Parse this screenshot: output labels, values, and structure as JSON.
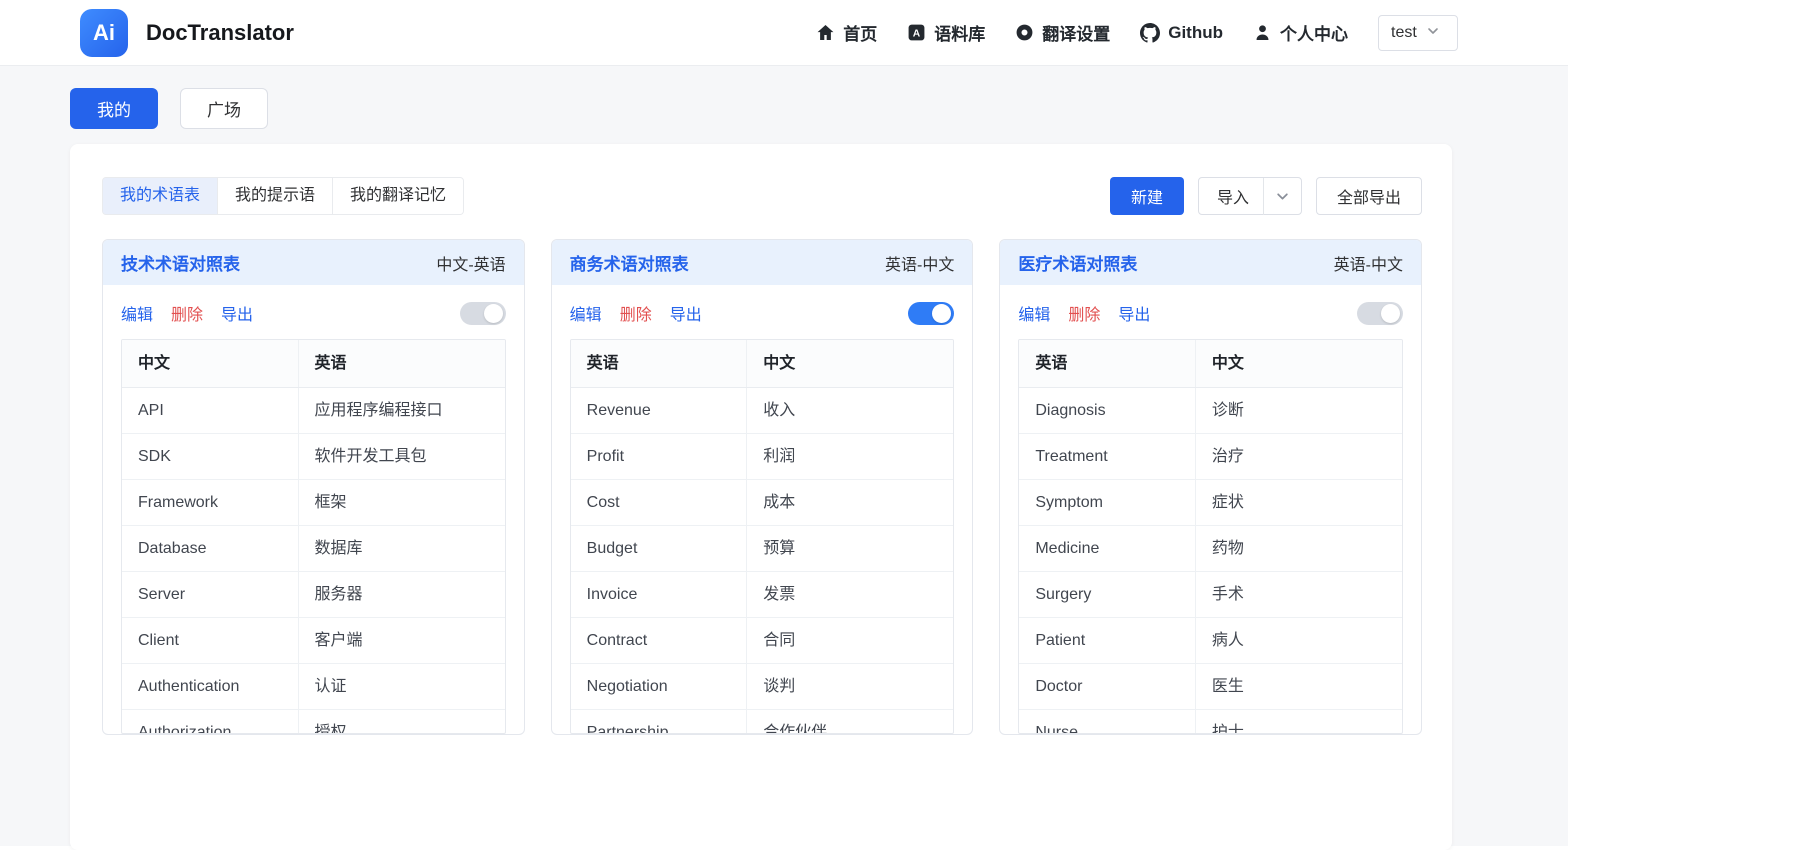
{
  "header": {
    "logo_text": "Ai",
    "app_name": "DocTranslator",
    "nav": [
      {
        "label": "首页",
        "icon": "home-icon"
      },
      {
        "label": "语料库",
        "icon": "corpus-icon"
      },
      {
        "label": "翻译设置",
        "icon": "settings-icon"
      },
      {
        "label": "Github",
        "icon": "github-icon"
      },
      {
        "label": "个人中心",
        "icon": "user-icon"
      }
    ],
    "user_dropdown": "test"
  },
  "view_tabs": {
    "mine": "我的",
    "plaza": "广场"
  },
  "panel": {
    "tabs": [
      "我的术语表",
      "我的提示语",
      "我的翻译记忆"
    ],
    "active_tab": "我的术语表",
    "actions": {
      "new": "新建",
      "import": "导入",
      "export_all": "全部导出"
    }
  },
  "glossaries": [
    {
      "title": "技术术语对照表",
      "lang_pair": "中文-英语",
      "actions": {
        "edit": "编辑",
        "delete": "删除",
        "export": "导出"
      },
      "toggle_on": false,
      "columns": [
        "中文",
        "英语"
      ],
      "rows": [
        [
          "API",
          "应用程序编程接口"
        ],
        [
          "SDK",
          "软件开发工具包"
        ],
        [
          "Framework",
          "框架"
        ],
        [
          "Database",
          "数据库"
        ],
        [
          "Server",
          "服务器"
        ],
        [
          "Client",
          "客户端"
        ],
        [
          "Authentication",
          "认证"
        ],
        [
          "Authorization",
          "授权"
        ]
      ]
    },
    {
      "title": "商务术语对照表",
      "lang_pair": "英语-中文",
      "actions": {
        "edit": "编辑",
        "delete": "删除",
        "export": "导出"
      },
      "toggle_on": true,
      "columns": [
        "英语",
        "中文"
      ],
      "rows": [
        [
          "Revenue",
          "收入"
        ],
        [
          "Profit",
          "利润"
        ],
        [
          "Cost",
          "成本"
        ],
        [
          "Budget",
          "预算"
        ],
        [
          "Invoice",
          "发票"
        ],
        [
          "Contract",
          "合同"
        ],
        [
          "Negotiation",
          "谈判"
        ],
        [
          "Partnership",
          "合作伙伴"
        ]
      ]
    },
    {
      "title": "医疗术语对照表",
      "lang_pair": "英语-中文",
      "actions": {
        "edit": "编辑",
        "delete": "删除",
        "export": "导出"
      },
      "toggle_on": false,
      "columns": [
        "英语",
        "中文"
      ],
      "rows": [
        [
          "Diagnosis",
          "诊断"
        ],
        [
          "Treatment",
          "治疗"
        ],
        [
          "Symptom",
          "症状"
        ],
        [
          "Medicine",
          "药物"
        ],
        [
          "Surgery",
          "手术"
        ],
        [
          "Patient",
          "病人"
        ],
        [
          "Doctor",
          "医生"
        ],
        [
          "Nurse",
          "护士"
        ]
      ]
    }
  ],
  "colors": {
    "primary": "#2563eb",
    "danger": "#e25050",
    "card_header_bg": "#e8f1fd",
    "page_bg": "#f6f7f9"
  }
}
